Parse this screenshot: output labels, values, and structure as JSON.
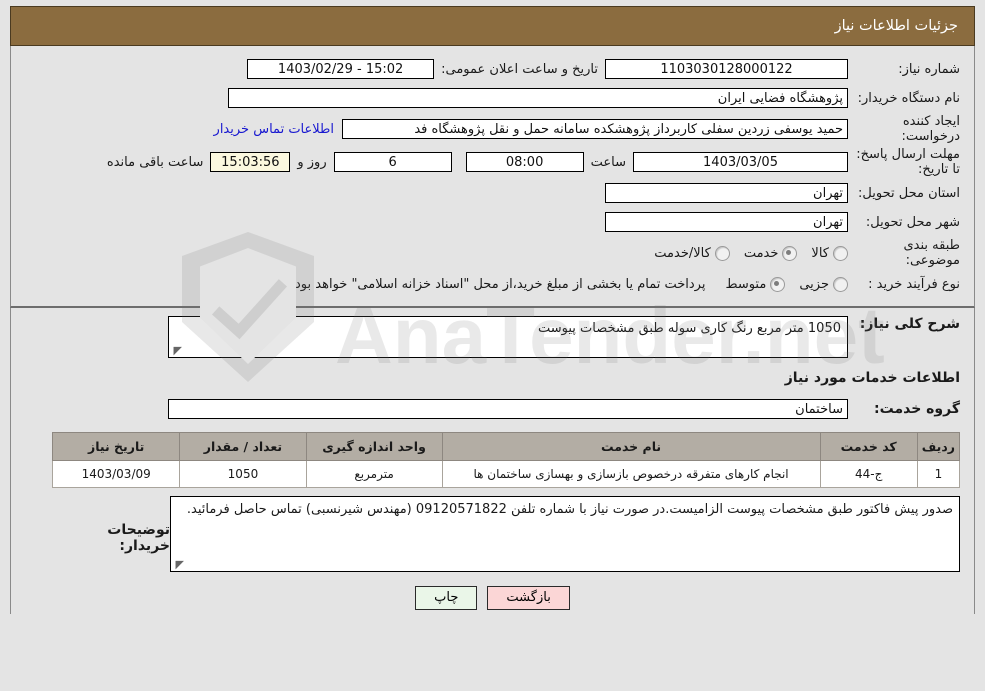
{
  "header": {
    "title": "جزئیات اطلاعات نیاز"
  },
  "info": {
    "need_no_label": "شماره نیاز:",
    "need_no_value": "1103030128000122",
    "public_announce_label": "تاریخ و ساعت اعلان عمومی:",
    "public_announce_value": "15:02 - 1403/02/29",
    "buyer_org_label": "نام دستگاه خریدار:",
    "buyer_org_value": "پژوهشگاه فضایی ایران",
    "creator_label": "ایجاد کننده درخواست:",
    "creator_value": "حمید یوسفی زردین سفلی کاربرداز پژوهشکده سامانه حمل و نقل پژوهشگاه فد",
    "buyer_contact_link": "اطلاعات تماس خریدار",
    "deadline_label": "مهلت ارسال پاسخ: تا تاریخ:",
    "deadline_date": "1403/03/05",
    "time_label": "ساعت",
    "time_value": "08:00",
    "days_value": "6",
    "days_label": "روز و",
    "remaining_value": "15:03:56",
    "remaining_label": "ساعت باقی مانده",
    "province_label": "استان محل تحویل:",
    "province_value": "تهران",
    "city_label": "شهر محل تحویل:",
    "city_value": "تهران",
    "category_label": "طبقه بندی موضوعی:",
    "category_options": [
      {
        "label": "کالا",
        "checked": false
      },
      {
        "label": "خدمت",
        "checked": true
      },
      {
        "label": "کالا/خدمت",
        "checked": false
      }
    ],
    "purchase_type_label": "نوع فرآیند خرید :",
    "purchase_type_options": [
      {
        "label": "جزیی",
        "checked": false
      },
      {
        "label": "متوسط",
        "checked": true
      }
    ],
    "islamic_treasury_note": "پرداخت تمام یا بخشی از مبلغ خرید،از محل \"اسناد خزانه اسلامی\" خواهد بود."
  },
  "middle": {
    "general_desc_label": "شرح کلی نیاز:",
    "general_desc_value": "1050 متر مربع رنگ کاری سوله طبق مشخصات پیوست",
    "services_section_title": "اطلاعات خدمات مورد نیاز",
    "service_group_label": "گروه خدمت:",
    "service_group_value": "ساختمان"
  },
  "table": {
    "headers": [
      "ردیف",
      "کد خدمت",
      "نام خدمت",
      "واحد اندازه گیری",
      "تعداد / مقدار",
      "تاریخ نیاز"
    ],
    "rows": [
      {
        "radif": "1",
        "code": "ج-44",
        "name": "انجام کارهای متفرقه درخصوص بازسازی و بهسازی ساختمان ها",
        "unit": "مترمربع",
        "qty": "1050",
        "date": "1403/03/09"
      }
    ]
  },
  "buyer_note": {
    "label": "توضیحات خریدار:",
    "value": "صدور پیش فاکتور طبق مشخصات پیوست الزامیست.در صورت نیاز با شماره تلفن 09120571822 (مهندس شیرنسبی) تماس حاصل فرمائید."
  },
  "footer": {
    "print_label": "چاپ",
    "back_label": "بازگشت"
  },
  "watermark": {
    "brand": "AnaTender.net"
  },
  "colors": {
    "header_bg": "#8b6c3f",
    "page_bg": "#e4e4e4",
    "table_header_bg": "#b3ada4",
    "link": "#1818d0",
    "highlight_field_bg": "#fbf8df",
    "print_btn_bg": "#eaf6e8",
    "back_btn_bg": "#fbd6d6"
  }
}
